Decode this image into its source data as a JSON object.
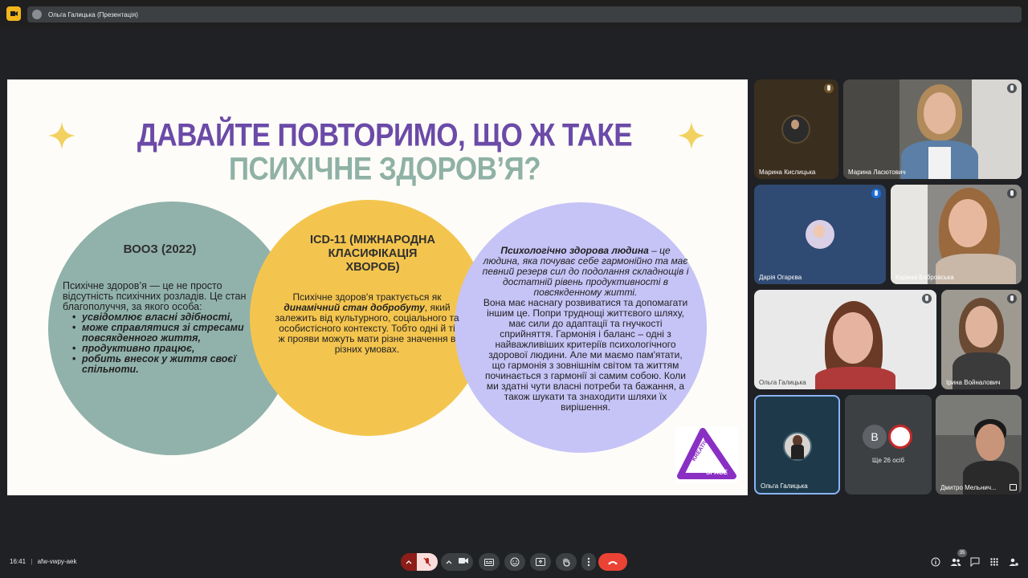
{
  "topbar": {
    "presenter_title": "Ольга Галицька (Презентація)"
  },
  "slide": {
    "title_line1": "ДАВАЙТЕ ПОВТОРИМО, ЩО Ж ТАКЕ",
    "title_line2": "ПСИХІЧНЕ ЗДОРОВ’Я?",
    "circle_left": {
      "heading": "ВООЗ (2022)",
      "intro": "Психічне здоров’я — це не просто відсутність психічних розладів. Це стан благополуччя, за якого особа:",
      "bullets": [
        "усвідомлює власні здібності,",
        "може справлятися зі стресами повсякденного життя,",
        "продуктивно працює,",
        "робить внесок у життя своєї спільноти."
      ]
    },
    "circle_middle": {
      "heading": "ICD-11 (МІЖНАРОДНА КЛАСИФІКАЦІЯ ХВОРОБ)",
      "text_before": "Психічне здоров'я трактується як",
      "text_bold": "динамічний стан добробуту",
      "text_after": ", який залежить від культурного, соціального та особистісного контексту. Тобто одні й ті ж прояви можуть мати різне значення в різних умовах."
    },
    "circle_right": {
      "intro_bold": "Психологічно здорова людина",
      "intro_rest": " – це людина, яка почуває себе гармонійно та має певний резерв сил до подолання складнощів і достатній рівень продуктивності в повсякденному житті.",
      "body": "Вона має наснагу розвиватися та допомагати іншим це. Попри труднощі життєвого шляху, має сили до адаптації та гнучкості сприйняття. Гармонія і баланс – одні з найважливіших критеріїв психологічного здорової людини. Але ми маємо пам'ятати, що гармонія з зовнішнім світом та життям починається з гармонії зі самим собою. Коли ми здатні чути власні потреби та бажання, а також шукати та знаходити шляхи їх вирішення."
    },
    "logo_top": "KREATIV",
    "logo_bottom": "SPACE"
  },
  "participants": [
    {
      "name": "Марина Кислицька"
    },
    {
      "name": "Марина Ласютович"
    },
    {
      "name": "Дарія Огарєва"
    },
    {
      "name": "Карина Бобровська"
    },
    {
      "name": "Ольга Галицька"
    },
    {
      "name": "Ірина Войналович"
    },
    {
      "name": "Ольга Галицька"
    },
    {
      "name": "Дмитро Мельнич..."
    }
  ],
  "others_tile": {
    "label": "Ще 26 осіб",
    "avatar_letter": "B"
  },
  "bottombar": {
    "time": "16:41",
    "separator": "|",
    "meeting_code": "afw-vwpy-aek",
    "participant_count": "35"
  },
  "colors": {
    "title_purple": "#6b4aa8",
    "title_green": "#8fb1a6",
    "circle_green": "#91b2aa",
    "circle_yellow": "#f4c54e",
    "circle_lavender": "#c6c3f6",
    "hangup_red": "#ea4335"
  }
}
